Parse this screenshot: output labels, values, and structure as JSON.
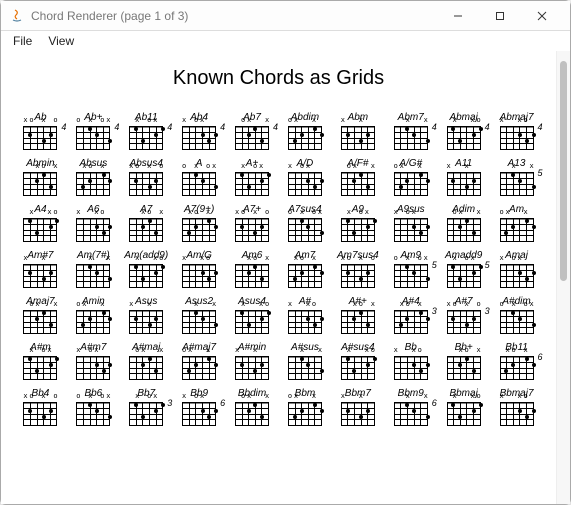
{
  "window": {
    "title": "Chord Renderer (page 1 of 3)"
  },
  "menus": {
    "file": "File",
    "view": "View"
  },
  "page": {
    "heading": "Known Chords as Grids"
  },
  "chords": [
    {
      "name": "Ab",
      "fret": "4"
    },
    {
      "name": "Ab+",
      "fret": "4"
    },
    {
      "name": "Ab11",
      "fret": "4"
    },
    {
      "name": "Ab4",
      "fret": "4"
    },
    {
      "name": "Ab7",
      "fret": "4"
    },
    {
      "name": "Abdim",
      "fret": ""
    },
    {
      "name": "Abm",
      "fret": ""
    },
    {
      "name": "Abm7",
      "fret": "4"
    },
    {
      "name": "Abmaj",
      "fret": "4"
    },
    {
      "name": "Abmaj7",
      "fret": "4"
    },
    {
      "name": "Abmin",
      "fret": ""
    },
    {
      "name": "Absus",
      "fret": ""
    },
    {
      "name": "Absus4",
      "fret": ""
    },
    {
      "name": "A",
      "fret": ""
    },
    {
      "name": "A+",
      "fret": ""
    },
    {
      "name": "A/D",
      "fret": ""
    },
    {
      "name": "A/F#",
      "fret": ""
    },
    {
      "name": "A/G#",
      "fret": ""
    },
    {
      "name": "A11",
      "fret": ""
    },
    {
      "name": "A13",
      "fret": "5"
    },
    {
      "name": "A4",
      "fret": ""
    },
    {
      "name": "A6",
      "fret": ""
    },
    {
      "name": "A7",
      "fret": ""
    },
    {
      "name": "A7(9+)",
      "fret": ""
    },
    {
      "name": "A7+",
      "fret": ""
    },
    {
      "name": "A7sus4",
      "fret": ""
    },
    {
      "name": "A9",
      "fret": ""
    },
    {
      "name": "A9sus",
      "fret": ""
    },
    {
      "name": "Adim",
      "fret": ""
    },
    {
      "name": "Am",
      "fret": ""
    },
    {
      "name": "Am#7",
      "fret": ""
    },
    {
      "name": "Am(7#)",
      "fret": ""
    },
    {
      "name": "Am(add9)",
      "fret": ""
    },
    {
      "name": "Am/G",
      "fret": ""
    },
    {
      "name": "Am6",
      "fret": ""
    },
    {
      "name": "Am7",
      "fret": ""
    },
    {
      "name": "Am7sus4",
      "fret": ""
    },
    {
      "name": "Am9",
      "fret": "5"
    },
    {
      "name": "Amadd9",
      "fret": "5"
    },
    {
      "name": "Amaj",
      "fret": ""
    },
    {
      "name": "Amaj7",
      "fret": ""
    },
    {
      "name": "Amin",
      "fret": ""
    },
    {
      "name": "Asus",
      "fret": ""
    },
    {
      "name": "Asus2",
      "fret": ""
    },
    {
      "name": "Asus4",
      "fret": ""
    },
    {
      "name": "A#",
      "fret": ""
    },
    {
      "name": "A#+",
      "fret": ""
    },
    {
      "name": "A#4",
      "fret": "3"
    },
    {
      "name": "A#7",
      "fret": "3"
    },
    {
      "name": "A#dim",
      "fret": ""
    },
    {
      "name": "A#m",
      "fret": ""
    },
    {
      "name": "A#m7",
      "fret": ""
    },
    {
      "name": "A#maj",
      "fret": ""
    },
    {
      "name": "A#maj7",
      "fret": ""
    },
    {
      "name": "A#min",
      "fret": ""
    },
    {
      "name": "A#sus",
      "fret": ""
    },
    {
      "name": "A#sus4",
      "fret": ""
    },
    {
      "name": "Bb",
      "fret": ""
    },
    {
      "name": "Bb+",
      "fret": ""
    },
    {
      "name": "Bb11",
      "fret": "6"
    },
    {
      "name": "Bb4",
      "fret": ""
    },
    {
      "name": "Bb6",
      "fret": ""
    },
    {
      "name": "Bb7",
      "fret": "3"
    },
    {
      "name": "Bb9",
      "fret": "6"
    },
    {
      "name": "Bbdim",
      "fret": ""
    },
    {
      "name": "Bbm",
      "fret": ""
    },
    {
      "name": "Bbm7",
      "fret": ""
    },
    {
      "name": "Bbm9",
      "fret": "6"
    },
    {
      "name": "Bbmaj",
      "fret": ""
    },
    {
      "name": "Bbmaj7",
      "fret": ""
    }
  ]
}
